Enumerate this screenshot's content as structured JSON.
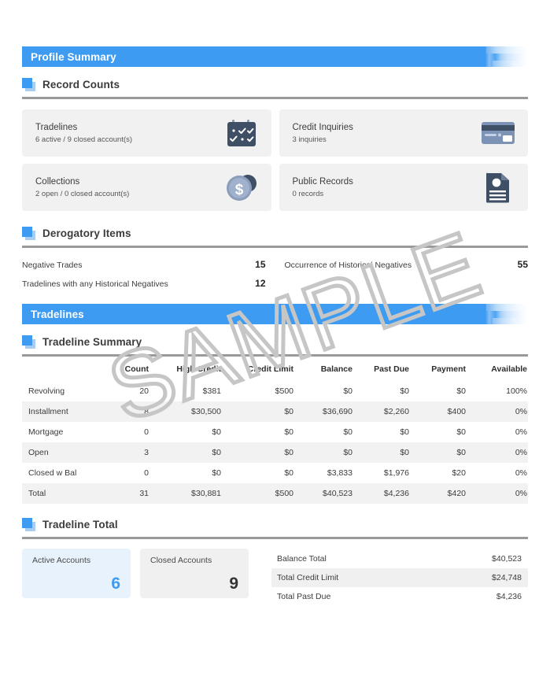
{
  "banners": {
    "profile_summary": "Profile Summary",
    "tradelines": "Tradelines"
  },
  "sections": {
    "record_counts": "Record Counts",
    "derogatory_items": "Derogatory Items",
    "tradeline_summary": "Tradeline Summary",
    "tradeline_total": "Tradeline Total"
  },
  "record_counts": {
    "cards": [
      {
        "label": "Tradelines",
        "sub": "6 active / 9 closed account(s)",
        "icon": "calendar-check-icon"
      },
      {
        "label": "Credit Inquiries",
        "sub": "3 inquiries",
        "icon": "credit-card-icon"
      },
      {
        "label": "Collections",
        "sub": "2 open / 0 closed account(s)",
        "icon": "dollar-coin-icon"
      },
      {
        "label": "Public Records",
        "sub": "0 records",
        "icon": "document-icon"
      }
    ]
  },
  "derogatory_items": {
    "left": [
      {
        "label": "Negative Trades",
        "value": "15"
      },
      {
        "label": "Tradelines with any Historical Negatives",
        "value": "12"
      }
    ],
    "right": [
      {
        "label": "Occurrence of Historical Negatives",
        "value": "55"
      }
    ]
  },
  "tradeline_summary": {
    "columns": [
      "",
      "Count",
      "High Credit",
      "Credit Limit",
      "Balance",
      "Past Due",
      "Payment",
      "Available"
    ],
    "rows": [
      [
        "Revolving",
        "20",
        "$381",
        "$500",
        "$0",
        "$0",
        "$0",
        "100%"
      ],
      [
        "Installment",
        "8",
        "$30,500",
        "$0",
        "$36,690",
        "$2,260",
        "$400",
        "0%"
      ],
      [
        "Mortgage",
        "0",
        "$0",
        "$0",
        "$0",
        "$0",
        "$0",
        "0%"
      ],
      [
        "Open",
        "3",
        "$0",
        "$0",
        "$0",
        "$0",
        "$0",
        "0%"
      ],
      [
        "Closed w Bal",
        "0",
        "$0",
        "$0",
        "$3,833",
        "$1,976",
        "$20",
        "0%"
      ],
      [
        "Total",
        "31",
        "$30,881",
        "$500",
        "$40,523",
        "$4,236",
        "$420",
        "0%"
      ]
    ]
  },
  "tradeline_total": {
    "active_accounts": {
      "label": "Active Accounts",
      "value": "6"
    },
    "closed_accounts": {
      "label": "Closed Accounts",
      "value": "9"
    },
    "totals": [
      {
        "label": "Balance Total",
        "value": "$40,523"
      },
      {
        "label": "Total Credit Limit",
        "value": "$24,748"
      },
      {
        "label": "Total Past Due",
        "value": "$4,236"
      }
    ]
  },
  "watermark": {
    "text": "SAMPLE"
  },
  "colors": {
    "accent_blue": "#3d9bf2",
    "icon_slate": "#3f4f66",
    "card_gray": "#f1f1f1",
    "active_card_blue": "#e8f2fd",
    "watermark_gray": "#c6c6c6"
  }
}
